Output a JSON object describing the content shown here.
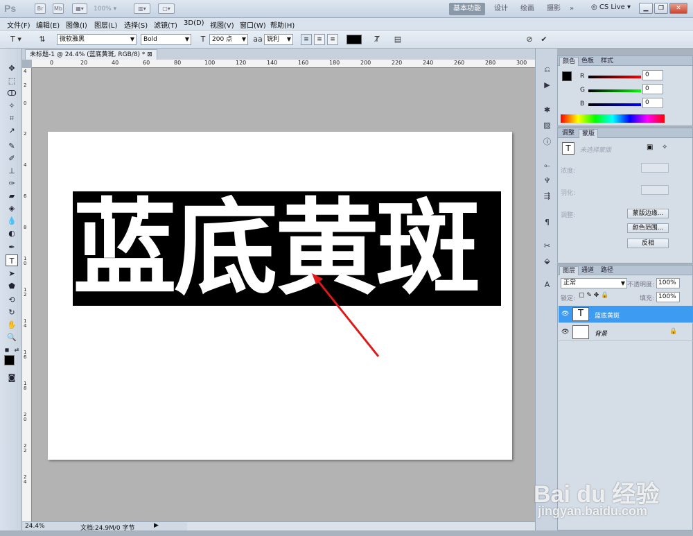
{
  "appbar": {
    "logo": "Ps",
    "icon_br": "Br",
    "icon_mb": "Mb",
    "zoom": "100%",
    "workspaces": [
      "基本功能",
      "设计",
      "绘画",
      "摄影"
    ],
    "more": "»",
    "cs_live": "CS Live"
  },
  "menu": [
    "文件(F)",
    "编辑(E)",
    "图像(I)",
    "图层(L)",
    "选择(S)",
    "滤镜(T)",
    "3D(D)",
    "视图(V)",
    "窗口(W)",
    "帮助(H)"
  ],
  "options": {
    "font_family": "微软雅黑",
    "font_style": "Bold",
    "font_size": "200 点",
    "aa_label": "aa",
    "antialias": "锐利",
    "text_color": "#000000"
  },
  "document": {
    "tab_title": "未标题-1 @ 24.4% (蓝底黄斑, RGB/8) *",
    "text": "蓝底黄斑"
  },
  "ruler": {
    "h_ticks": [
      "0",
      "20",
      "40",
      "60",
      "80",
      "100",
      "120",
      "140",
      "160",
      "180",
      "200",
      "220",
      "240",
      "260",
      "280",
      "300"
    ],
    "v_ticks": [
      "4",
      "2",
      "0",
      "2",
      "4",
      "6",
      "8",
      "10",
      "12",
      "14",
      "16",
      "18",
      "20",
      "22",
      "24"
    ]
  },
  "status": {
    "zoom": "24.4%",
    "doc_info": "文档:24.9M/0 字节"
  },
  "color_panel": {
    "tabs": [
      "颜色",
      "色板",
      "样式"
    ],
    "r_label": "R",
    "g_label": "G",
    "b_label": "B",
    "r": "0",
    "g": "0",
    "b": "0"
  },
  "mask_panel": {
    "tabs": [
      "调整",
      "蒙版"
    ],
    "no_selection": "未选择蒙版",
    "density": "浓度:",
    "feather": "羽化:",
    "refine": "调整:",
    "btn_edge": "蒙版边缘...",
    "btn_range": "颜色范围...",
    "btn_invert": "反相"
  },
  "layers_panel": {
    "tabs": [
      "图层",
      "通道",
      "路径"
    ],
    "blend_mode": "正常",
    "opacity_label": "不透明度:",
    "opacity": "100%",
    "lock_label": "锁定:",
    "fill_label": "填充:",
    "fill": "100%",
    "layers": [
      {
        "name": "蓝底黄斑",
        "thumb": "T",
        "selected": true
      },
      {
        "name": "背景",
        "thumb": "",
        "selected": false
      }
    ]
  },
  "watermark": {
    "brand": "Bai du 经验",
    "url": "jingyan.baidu.com"
  }
}
